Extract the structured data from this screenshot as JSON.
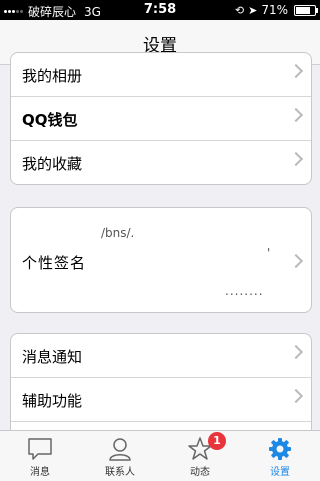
{
  "status_bar": {
    "carrier": "破碎辰心",
    "network": "3G",
    "time": "7:58",
    "battery": "71%",
    "battery_level": 0.71
  },
  "nav": {
    "title": "设置"
  },
  "group1": {
    "items": [
      {
        "label": "我的相册"
      },
      {
        "label": "QQ钱包"
      },
      {
        "label": "我的收藏"
      }
    ]
  },
  "signature": {
    "label": "个性签名",
    "line1": "/bns/.",
    "mark": "'",
    "dots": "........"
  },
  "group3": {
    "items": [
      {
        "label": "消息通知"
      },
      {
        "label": "辅助功能"
      }
    ]
  },
  "tabs": [
    {
      "label": "消息",
      "icon": "chat-bubble-icon"
    },
    {
      "label": "联系人",
      "icon": "person-icon"
    },
    {
      "label": "动态",
      "icon": "star-icon",
      "badge": "1"
    },
    {
      "label": "设置",
      "icon": "gear-icon",
      "active": true
    }
  ],
  "colors": {
    "accent": "#1e88e5",
    "badge": "#e8353b"
  }
}
